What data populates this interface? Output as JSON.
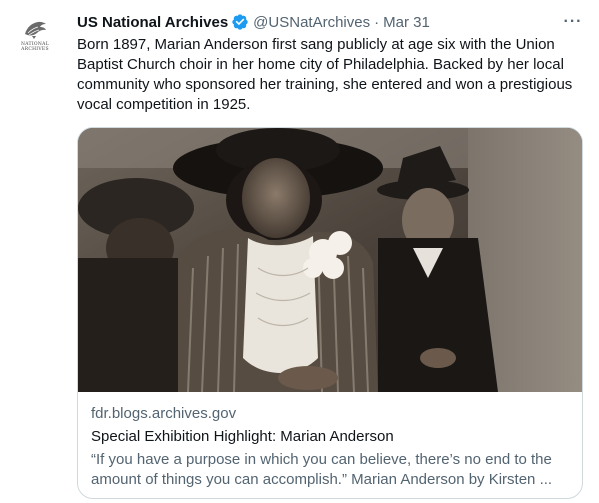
{
  "account": {
    "display_name": "US National Archives",
    "handle": "@USNatArchives",
    "separator": "·",
    "timestamp": "Mar 31",
    "logo_text_line1": "NATIONAL",
    "logo_text_line2": "ARCHIVES",
    "verified_color": "#1d9bf0"
  },
  "tweet": {
    "text": "Born 1897, Marian Anderson first sang publicly at age six with the Union Baptist Church choir in her home city of Philadelphia. Backed by her local community who sponsored her training, she entered and won a prestigious vocal competition in 1925."
  },
  "menu": {
    "more_label": "···"
  },
  "card": {
    "domain": "fdr.blogs.archives.gov",
    "title": "Special Exhibition Highlight: Marian Anderson",
    "description": "“If you have a purpose in which you can believe, there’s no end to the amount of things you can accomplish.” Marian Anderson by Kirsten ..."
  },
  "icons": {
    "avatar": "eagle-logo-icon",
    "verified": "verified-badge-icon",
    "more": "more-options-icon"
  }
}
